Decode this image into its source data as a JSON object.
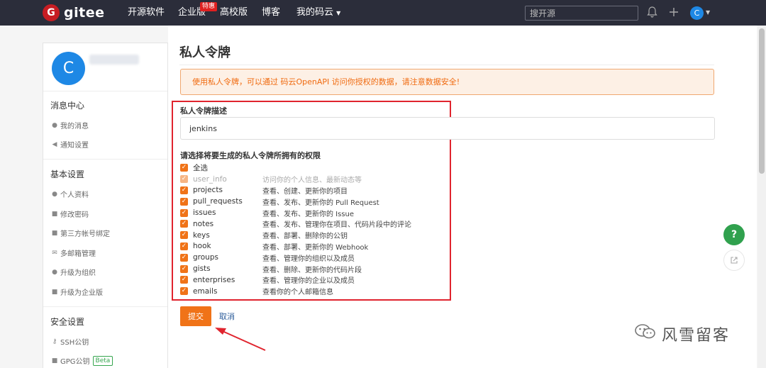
{
  "nav": {
    "logo_mark": "G",
    "logo_text": "gitee",
    "items": [
      "开源软件",
      "企业版",
      "高校版",
      "博客",
      "我的码云"
    ],
    "enterprise_badge": "特惠",
    "search_placeholder": "搜开源",
    "avatar_letter": "C"
  },
  "sidebar": {
    "avatar_letter": "C",
    "sections": [
      {
        "title": "消息中心",
        "items": [
          "我的消息",
          "通知设置"
        ]
      },
      {
        "title": "基本设置",
        "items": [
          "个人资料",
          "修改密码",
          "第三方帐号绑定",
          "多邮箱管理",
          "升级为组织",
          "升级为企业版"
        ]
      },
      {
        "title": "安全设置",
        "items": [
          "SSH公钥",
          "GPG公钥"
        ]
      }
    ],
    "beta_label": "Beta"
  },
  "main": {
    "title": "私人令牌",
    "alert": "使用私人令牌，可以通过 码云OpenAPI 访问你授权的数据，请注意数据安全!",
    "desc_label": "私人令牌描述",
    "desc_value": "jenkins",
    "scope_label": "请选择将要生成的私人令牌所拥有的权限",
    "select_all": "全选",
    "permissions": [
      {
        "name": "user_info",
        "desc": "访问你的个人信息、最新动态等"
      },
      {
        "name": "projects",
        "desc": "查看、创建、更新你的项目"
      },
      {
        "name": "pull_requests",
        "desc": "查看、发布、更新你的 Pull Request"
      },
      {
        "name": "issues",
        "desc": "查看、发布、更新你的 Issue"
      },
      {
        "name": "notes",
        "desc": "查看、发布、管理你在项目、代码片段中的评论"
      },
      {
        "name": "keys",
        "desc": "查看、部署、删除你的公钥"
      },
      {
        "name": "hook",
        "desc": "查看、部署、更新你的 Webhook"
      },
      {
        "name": "groups",
        "desc": "查看、管理你的组织以及成员"
      },
      {
        "name": "gists",
        "desc": "查看、删除、更新你的代码片段"
      },
      {
        "name": "enterprises",
        "desc": "查看、管理你的企业以及成员"
      },
      {
        "name": "emails",
        "desc": "查看你的个人邮箱信息"
      }
    ],
    "submit_label": "提交",
    "cancel_label": "取消"
  },
  "float": {
    "help": "?"
  },
  "watermark": "风雪留客",
  "colors": {
    "accent": "#f07318",
    "nav_bg": "#2b2d3a",
    "highlight": "#e0242e"
  }
}
